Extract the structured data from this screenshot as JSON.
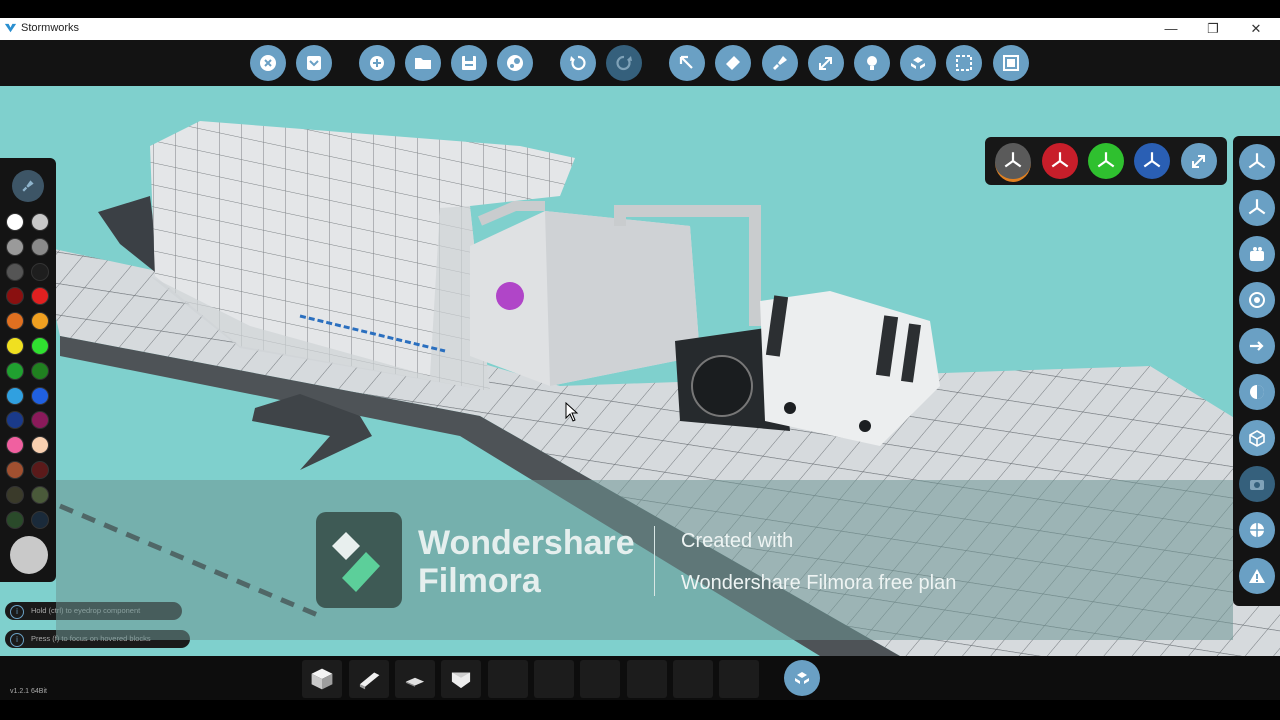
{
  "window": {
    "title": "Stormworks",
    "controls": [
      "minimize-icon",
      "restore-icon",
      "close-icon"
    ]
  },
  "toolbar": {
    "buttons": [
      {
        "name": "close-editor-button",
        "icon": "close-circle-icon",
        "enabled": true
      },
      {
        "name": "collapse-button",
        "icon": "chevron-down-icon",
        "enabled": true
      },
      {
        "name": "new-button",
        "icon": "plus-icon",
        "enabled": true
      },
      {
        "name": "open-button",
        "icon": "folder-icon",
        "enabled": true
      },
      {
        "name": "save-button",
        "icon": "save-icon",
        "enabled": true
      },
      {
        "name": "workshop-button",
        "icon": "steam-icon",
        "enabled": true
      },
      {
        "name": "undo-button",
        "icon": "undo-icon",
        "enabled": true
      },
      {
        "name": "redo-button",
        "icon": "redo-icon",
        "enabled": false
      },
      {
        "name": "select-tool-button",
        "icon": "cursor-arrow-icon",
        "enabled": true
      },
      {
        "name": "erase-tool-button",
        "icon": "eraser-icon",
        "enabled": true
      },
      {
        "name": "paint-tool-button",
        "icon": "paint-brush-icon",
        "enabled": true
      },
      {
        "name": "logic-tool-button",
        "icon": "logic-nodes-icon",
        "enabled": true
      },
      {
        "name": "light-tool-button",
        "icon": "lightbulb-icon",
        "enabled": true
      },
      {
        "name": "assembly-tool-button",
        "icon": "assembly-icon",
        "enabled": true
      },
      {
        "name": "selection-area-button",
        "icon": "dashed-select-icon",
        "enabled": true
      },
      {
        "name": "merge-button",
        "icon": "frame-icon",
        "enabled": true
      }
    ],
    "accent": "#6aa0c4"
  },
  "palette": {
    "swatches": [
      [
        "#ffffff",
        "#c8c8c8"
      ],
      [
        "#9a9a9a",
        "#8a8a8a"
      ],
      [
        "#555555",
        "#1e1e1e"
      ],
      [
        "#8a1010",
        "#e02020"
      ],
      [
        "#e07020",
        "#f0a020"
      ],
      [
        "#f0e020",
        "#30e030"
      ],
      [
        "#20a030",
        "#208020"
      ],
      [
        "#30a0e0",
        "#2060e0"
      ],
      [
        "#1a3a8a",
        "#8a1a5a"
      ],
      [
        "#f060a0",
        "#f8d0b0"
      ],
      [
        "#a05030",
        "#5a1a1a"
      ],
      [
        "#3a3a2a",
        "#4a5a3a"
      ],
      [
        "#2a4a2a",
        "#1a2a3a"
      ]
    ],
    "selected_color": "#c9c9c9"
  },
  "hints": [
    {
      "icon": "info-icon",
      "text": "Hold (ctrl) to eyedrop component"
    },
    {
      "icon": "info-icon",
      "text": "Press (f) to focus on hovered blocks"
    }
  ],
  "view_axes": [
    {
      "name": "axis-free",
      "color": "#5a5a5a",
      "icon": "axis-tripod-icon"
    },
    {
      "name": "axis-x",
      "color": "#c81e2a",
      "icon": "axis-tripod-icon"
    },
    {
      "name": "axis-y",
      "color": "#2fc02f",
      "icon": "axis-tripod-icon"
    },
    {
      "name": "axis-z",
      "color": "#2a5fb4",
      "icon": "axis-tripod-icon"
    },
    {
      "name": "axis-reset",
      "color": "#6aa0c4",
      "icon": "reset-arrow-icon"
    }
  ],
  "rightbar": {
    "buttons": [
      {
        "name": "view-perspective-button",
        "icon": "axis-tripod-icon",
        "enabled": true
      },
      {
        "name": "view-ortho-button",
        "icon": "axis-tripod-icon",
        "enabled": true
      },
      {
        "name": "camera-button",
        "icon": "camera-icon",
        "enabled": true
      },
      {
        "name": "center-button",
        "icon": "target-icon",
        "enabled": true
      },
      {
        "name": "move-button",
        "icon": "move-arrow-icon",
        "enabled": true
      },
      {
        "name": "ballast-button",
        "icon": "buoyancy-icon",
        "enabled": true
      },
      {
        "name": "cube-view-button",
        "icon": "cube-outline-icon",
        "enabled": true
      },
      {
        "name": "screenshot-button",
        "icon": "camera-lens-icon",
        "enabled": false
      },
      {
        "name": "globe-button",
        "icon": "globe-icon",
        "enabled": true
      },
      {
        "name": "warning-button",
        "icon": "warning-icon",
        "enabled": true
      }
    ]
  },
  "watermark": {
    "brand_line1": "Wondershare",
    "brand_line2": "Filmora",
    "created_line1": "Created with",
    "created_line2": "Wondershare Filmora free plan"
  },
  "bottombar": {
    "version": "v1.2.1 64Bit",
    "slots": [
      {
        "name": "slot-cube-block",
        "icon": "cube-block-icon"
      },
      {
        "name": "slot-wedge-block",
        "icon": "wedge-block-icon"
      },
      {
        "name": "slot-slope-block",
        "icon": "slope-block-icon"
      },
      {
        "name": "slot-pyramid-block",
        "icon": "pyramid-block-icon"
      },
      {
        "name": "slot-empty-5",
        "icon": ""
      },
      {
        "name": "slot-empty-6",
        "icon": ""
      },
      {
        "name": "slot-empty-7",
        "icon": ""
      },
      {
        "name": "slot-empty-8",
        "icon": ""
      },
      {
        "name": "slot-empty-9",
        "icon": ""
      },
      {
        "name": "slot-empty-10",
        "icon": ""
      }
    ],
    "assembly_icon": "assembly-icon"
  },
  "colors": {
    "sky": "#7fd0cd",
    "panel": "#141414"
  }
}
